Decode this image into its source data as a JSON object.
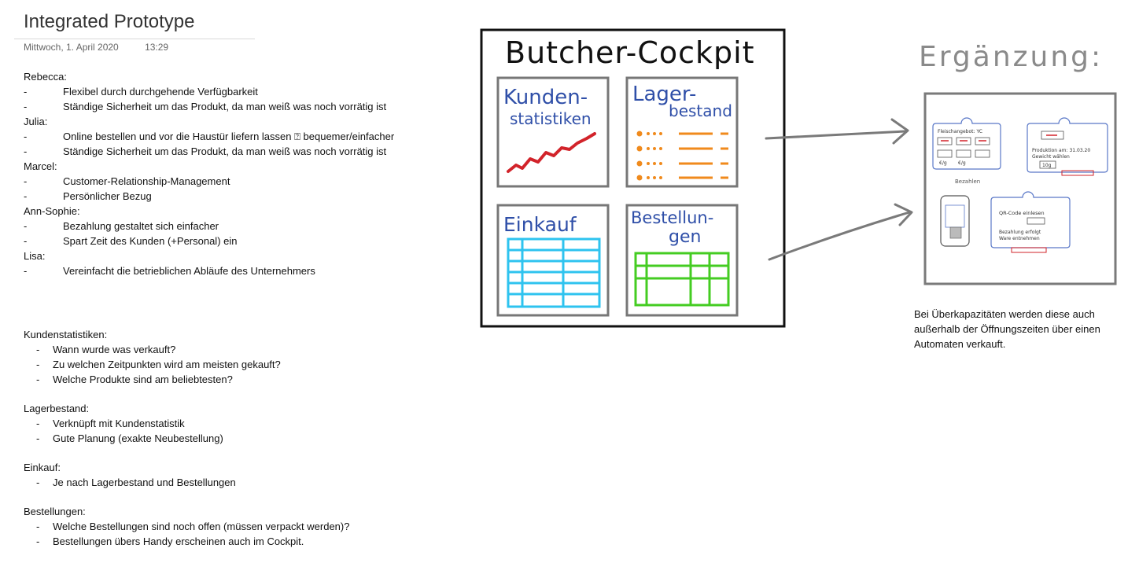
{
  "page": {
    "title": "Integrated Prototype",
    "date": "Mittwoch, 1. April 2020",
    "time": "13:29"
  },
  "notes": [
    {
      "name": "Rebecca:",
      "points": [
        "Flexibel durch durchgehende Verfügbarkeit",
        "Ständige Sicherheit um das Produkt, da man weiß was noch vorrätig ist"
      ]
    },
    {
      "name": "Julia:",
      "points": [
        "Online bestellen und vor die Haustür liefern lassen ⍰ bequemer/einfacher",
        "Ständige Sicherheit um das Produkt, da man weiß was noch vorrätig ist"
      ]
    },
    {
      "name": "Marcel:",
      "points": [
        "Customer-Relationship-Management",
        "Persönlicher Bezug"
      ]
    },
    {
      "name": "Ann-Sophie:",
      "points": [
        "Bezahlung gestaltet sich einfacher",
        "Spart Zeit des Kunden (+Personal) ein"
      ]
    },
    {
      "name": "Lisa:",
      "points": [
        "Vereinfacht die betrieblichen Abläufe des Unternehmers"
      ]
    }
  ],
  "topics": [
    {
      "heading": "Kundenstatistiken:",
      "items": [
        "Wann wurde was verkauft?",
        "Zu welchen Zeitpunkten wird am meisten gekauft?",
        "Welche Produkte sind am beliebtesten?"
      ]
    },
    {
      "heading": "Lagerbestand:",
      "items": [
        "Verknüpft mit Kundenstatistik",
        "Gute Planung (exakte Neubestellung)"
      ]
    },
    {
      "heading": "Einkauf:",
      "items": [
        "Je nach Lagerbestand und Bestellungen"
      ]
    },
    {
      "heading": "Bestellungen:",
      "items": [
        "Welche Bestellungen sind noch offen (müssen verpackt werden)?",
        "Bestellungen übers Handy erscheinen auch im Cockpit."
      ]
    }
  ],
  "sketch": {
    "title": "Butcher-Cockpit",
    "panels": {
      "kunden_line1": "Kunden-",
      "kunden_line2": "statistiken",
      "lager_line1": "Lager-",
      "lager_line2": "bestand",
      "einkauf": "Einkauf",
      "bestell_line1": "Bestellun-",
      "bestell_line2": "gen"
    }
  },
  "extra": {
    "title": "Ergänzung:",
    "mockup": {
      "shop_label": "Fleischangebot: YC",
      "price_a": "€/g",
      "price_b": "€/g",
      "pay_label": "Bezahlen",
      "prod_label": "Produktion am: 31.03.20",
      "weight_label": "Gewicht wählen",
      "weight_value": "10g",
      "qr_label": "QR-Code einlesen",
      "paid_line1": "Bezahlung erfolgt",
      "paid_line2": "Ware entnehmen"
    },
    "caption": "Bei Überkapazitäten werden diese auch außerhalb der Öffnungszeiten über einen Automaten verkauft."
  },
  "colors": {
    "blue_ink": "#2f4fa8",
    "red_ink": "#d2232a",
    "orange_ink": "#f08a1c",
    "cyan_ink": "#2ec3ef",
    "green_ink": "#44cc22",
    "gray_frame": "#7a7a7a"
  }
}
